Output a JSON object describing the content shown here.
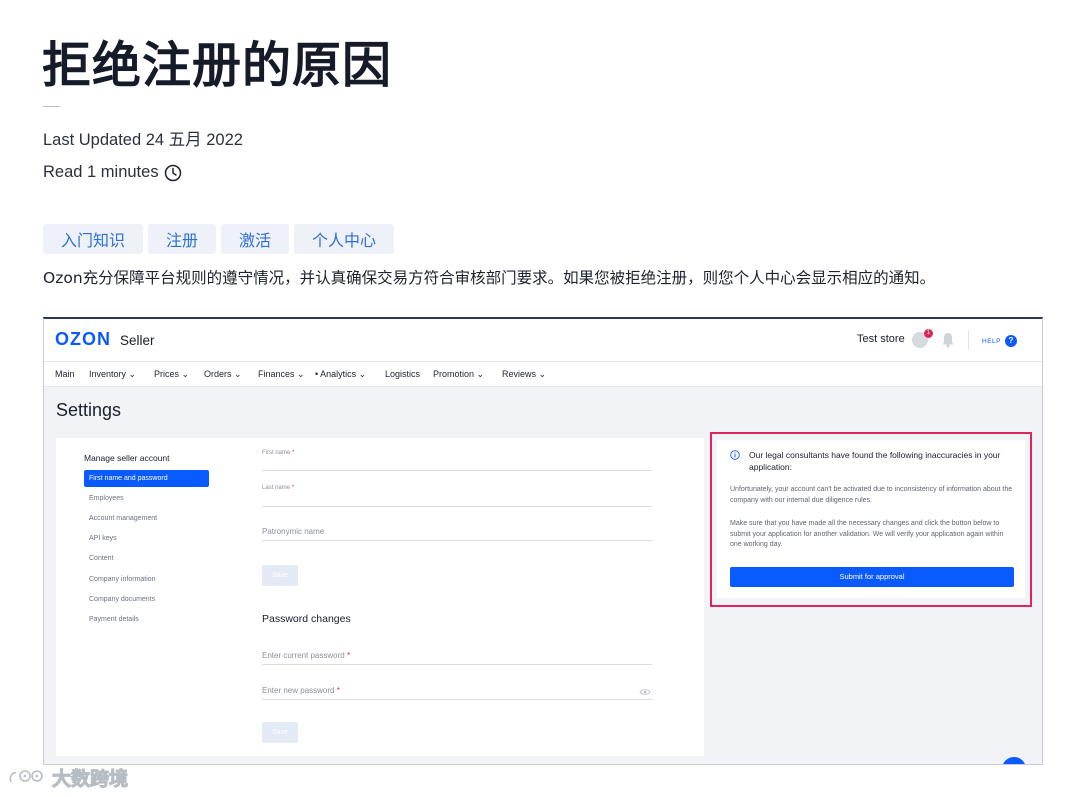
{
  "article": {
    "title": "拒绝注册的原因",
    "last_updated": "Last Updated 24 五月 2022",
    "read_time": "Read 1 minutes",
    "tags": [
      "入门知识",
      "注册",
      "激活",
      "个人中心"
    ],
    "intro": "Ozon充分保障平台规则的遵守情况，并认真确保交易方符合审核部门要求。如果您被拒绝注册，则您个人中心会显示相应的通知。"
  },
  "screenshot": {
    "header": {
      "logo": "OZON",
      "logo_sub": "Seller",
      "store": "Test store",
      "badge": "1",
      "help": "HELP",
      "help_icon": "?"
    },
    "nav": [
      "Main",
      "Inventory ⌄",
      "Prices ⌄",
      "Orders ⌄",
      "Finances ⌄",
      "• Analytics ⌄",
      "Logistics",
      "Promotion ⌄",
      "Reviews ⌄"
    ],
    "settings_title": "Settings",
    "sidebar": {
      "heading": "Manage seller account",
      "items": [
        "First name and password",
        "Employees",
        "Account management",
        "API keys",
        "Content",
        "Company information",
        "Company documents",
        "Payment details"
      ]
    },
    "form": {
      "first_name": "First name",
      "last_name": "Last name",
      "patronymic": "Patronymic name",
      "save": "Save",
      "password_heading": "Password changes",
      "current_password": "Enter current password",
      "new_password": "Enter new password",
      "required_mark": "*"
    },
    "alert": {
      "title": "Our legal consultants have found the following inaccuracies in your application:",
      "text1": "Unfortunately, your account can't be activated due to inconsistency of information about the company with our internal due diligence rules.",
      "text2": "Make sure that you have made all the necessary changes and click the button below to submit your application for another validation. We will verify your application again within one working day.",
      "button": "Submit for approval",
      "highlight_color": "#e0245e"
    }
  },
  "watermark": "大数跨境",
  "colors": {
    "accent": "#0a5bff",
    "tag_text": "#2e6fd6",
    "tag_bg": "#eef2f8"
  }
}
